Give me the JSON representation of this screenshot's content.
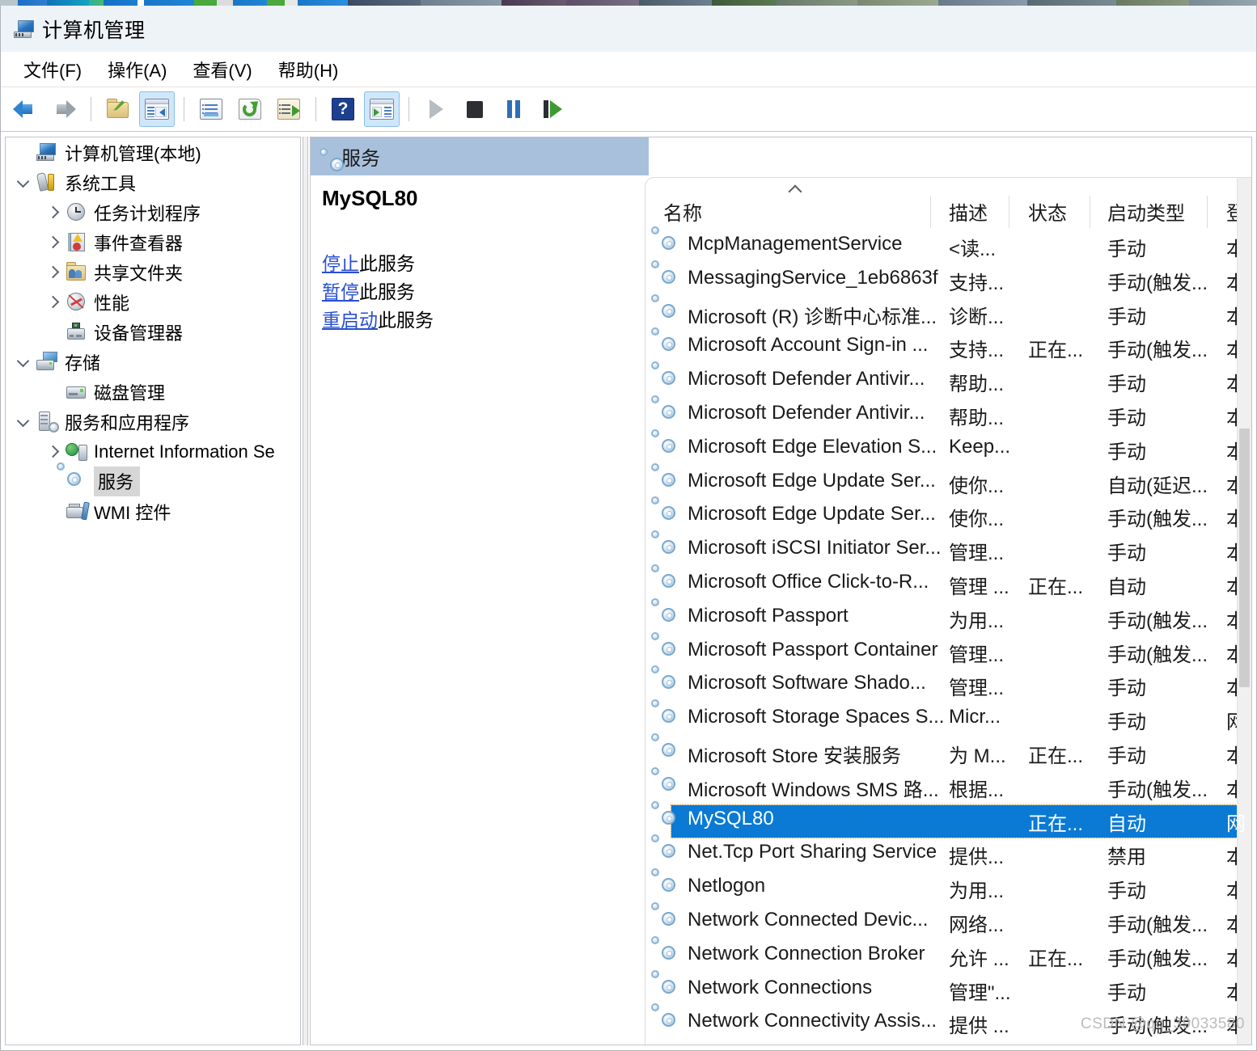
{
  "window": {
    "title": "计算机管理",
    "icon": "computer-management-icon"
  },
  "menubar": {
    "items": [
      {
        "label": "文件(F)",
        "name": "menu-file"
      },
      {
        "label": "操作(A)",
        "name": "menu-action"
      },
      {
        "label": "查看(V)",
        "name": "menu-view"
      },
      {
        "label": "帮助(H)",
        "name": "menu-help"
      }
    ]
  },
  "toolbar": {
    "buttons": [
      {
        "icon": "back-arrow-icon",
        "active": false
      },
      {
        "icon": "forward-arrow-icon",
        "active": false
      },
      {
        "icon": "up-folder-icon",
        "active": false
      },
      {
        "icon": "show-hide-console-tree-icon",
        "active": true
      },
      {
        "icon": "properties-icon",
        "active": false
      },
      {
        "icon": "refresh-icon",
        "active": false
      },
      {
        "icon": "export-list-icon",
        "active": false
      },
      {
        "icon": "help-icon",
        "active": false
      },
      {
        "icon": "show-hide-action-pane-icon",
        "active": true
      },
      {
        "icon": "start-service-icon",
        "active": false
      },
      {
        "icon": "stop-service-icon",
        "active": false
      },
      {
        "icon": "pause-service-icon",
        "active": false
      },
      {
        "icon": "restart-service-icon",
        "active": false
      }
    ]
  },
  "tree": {
    "items": [
      {
        "label": "计算机管理(本地)",
        "icon": "computer-icon",
        "indent": 0,
        "twisty": "none",
        "selected": false
      },
      {
        "label": "系统工具",
        "icon": "system-tools-icon",
        "indent": 1,
        "twisty": "expanded",
        "selected": false
      },
      {
        "label": "任务计划程序",
        "icon": "task-scheduler-icon",
        "indent": 2,
        "twisty": "collapsed",
        "selected": false
      },
      {
        "label": "事件查看器",
        "icon": "event-viewer-icon",
        "indent": 2,
        "twisty": "collapsed",
        "selected": false
      },
      {
        "label": "共享文件夹",
        "icon": "shared-folders-icon",
        "indent": 2,
        "twisty": "collapsed",
        "selected": false
      },
      {
        "label": "性能",
        "icon": "performance-icon",
        "indent": 2,
        "twisty": "collapsed",
        "selected": false
      },
      {
        "label": "设备管理器",
        "icon": "device-manager-icon",
        "indent": 2,
        "twisty": "none",
        "selected": false
      },
      {
        "label": "存储",
        "icon": "storage-icon",
        "indent": 1,
        "twisty": "expanded",
        "selected": false
      },
      {
        "label": "磁盘管理",
        "icon": "disk-management-icon",
        "indent": 2,
        "twisty": "none",
        "selected": false
      },
      {
        "label": "服务和应用程序",
        "icon": "services-and-applications-icon",
        "indent": 1,
        "twisty": "expanded",
        "selected": false
      },
      {
        "label": "Internet Information Se",
        "icon": "iis-icon",
        "indent": 2,
        "twisty": "collapsed",
        "selected": false
      },
      {
        "label": "服务",
        "icon": "services-icon",
        "indent": 2,
        "twisty": "none",
        "selected": true
      },
      {
        "label": "WMI 控件",
        "icon": "wmi-control-icon",
        "indent": 2,
        "twisty": "none",
        "selected": false
      }
    ]
  },
  "detail": {
    "header_title": "服务",
    "header_icon": "services-icon",
    "service_name": "MySQL80",
    "actions": [
      {
        "link": "停止",
        "suffix": "此服务",
        "name": "stop-service-link"
      },
      {
        "link": "暂停",
        "suffix": "此服务",
        "name": "pause-service-link"
      },
      {
        "link": "重启动",
        "suffix": "此服务",
        "name": "restart-service-link"
      }
    ]
  },
  "services_table": {
    "sort_column": "名称",
    "sort_direction": "ascending",
    "columns": [
      {
        "label": "名称",
        "key": "name"
      },
      {
        "label": "描述",
        "key": "description"
      },
      {
        "label": "状态",
        "key": "status"
      },
      {
        "label": "启动类型",
        "key": "startup"
      },
      {
        "label": "登",
        "key": "logon"
      }
    ],
    "rows": [
      {
        "name": "McpManagementService",
        "description": "<读...",
        "status": "",
        "startup": "手动",
        "logon": "本",
        "selected": false
      },
      {
        "name": "MessagingService_1eb6863f",
        "description": "支持...",
        "status": "",
        "startup": "手动(触发...",
        "logon": "本",
        "selected": false
      },
      {
        "name": "Microsoft (R) 诊断中心标准...",
        "description": "诊断...",
        "status": "",
        "startup": "手动",
        "logon": "本",
        "selected": false
      },
      {
        "name": "Microsoft Account Sign-in ...",
        "description": "支持...",
        "status": "正在...",
        "startup": "手动(触发...",
        "logon": "本",
        "selected": false
      },
      {
        "name": "Microsoft Defender Antivir...",
        "description": "帮助...",
        "status": "",
        "startup": "手动",
        "logon": "本",
        "selected": false
      },
      {
        "name": "Microsoft Defender Antivir...",
        "description": "帮助...",
        "status": "",
        "startup": "手动",
        "logon": "本",
        "selected": false
      },
      {
        "name": "Microsoft Edge Elevation S...",
        "description": "Keep...",
        "status": "",
        "startup": "手动",
        "logon": "本",
        "selected": false
      },
      {
        "name": "Microsoft Edge Update Ser...",
        "description": "使你...",
        "status": "",
        "startup": "自动(延迟...",
        "logon": "本",
        "selected": false
      },
      {
        "name": "Microsoft Edge Update Ser...",
        "description": "使你...",
        "status": "",
        "startup": "手动(触发...",
        "logon": "本",
        "selected": false
      },
      {
        "name": "Microsoft iSCSI Initiator Ser...",
        "description": "管理...",
        "status": "",
        "startup": "手动",
        "logon": "本",
        "selected": false
      },
      {
        "name": "Microsoft Office Click-to-R...",
        "description": "管理 ...",
        "status": "正在...",
        "startup": "自动",
        "logon": "本",
        "selected": false
      },
      {
        "name": "Microsoft Passport",
        "description": "为用...",
        "status": "",
        "startup": "手动(触发...",
        "logon": "本",
        "selected": false
      },
      {
        "name": "Microsoft Passport Container",
        "description": "管理...",
        "status": "",
        "startup": "手动(触发...",
        "logon": "本",
        "selected": false
      },
      {
        "name": "Microsoft Software Shado...",
        "description": "管理...",
        "status": "",
        "startup": "手动",
        "logon": "本",
        "selected": false
      },
      {
        "name": "Microsoft Storage Spaces S...",
        "description": "Micr...",
        "status": "",
        "startup": "手动",
        "logon": "网",
        "selected": false
      },
      {
        "name": "Microsoft Store 安装服务",
        "description": "为 M...",
        "status": "正在...",
        "startup": "手动",
        "logon": "本",
        "selected": false
      },
      {
        "name": "Microsoft Windows SMS 路...",
        "description": "根据...",
        "status": "",
        "startup": "手动(触发...",
        "logon": "本",
        "selected": false
      },
      {
        "name": "MySQL80",
        "description": "",
        "status": "正在...",
        "startup": "自动",
        "logon": "网",
        "selected": true
      },
      {
        "name": "Net.Tcp Port Sharing Service",
        "description": "提供...",
        "status": "",
        "startup": "禁用",
        "logon": "本",
        "selected": false
      },
      {
        "name": "Netlogon",
        "description": "为用...",
        "status": "",
        "startup": "手动",
        "logon": "本",
        "selected": false
      },
      {
        "name": "Network Connected Devic...",
        "description": "网络...",
        "status": "",
        "startup": "手动(触发...",
        "logon": "本",
        "selected": false
      },
      {
        "name": "Network Connection Broker",
        "description": "允许 ...",
        "status": "正在...",
        "startup": "手动(触发...",
        "logon": "本",
        "selected": false
      },
      {
        "name": "Network Connections",
        "description": "管理\"...",
        "status": "",
        "startup": "手动",
        "logon": "本",
        "selected": false
      },
      {
        "name": "Network Connectivity Assis...",
        "description": "提供 ...",
        "status": "",
        "startup": "手动(触发...",
        "logon": "本",
        "selected": false
      }
    ]
  },
  "watermark": "CSDN @qq_39033580"
}
